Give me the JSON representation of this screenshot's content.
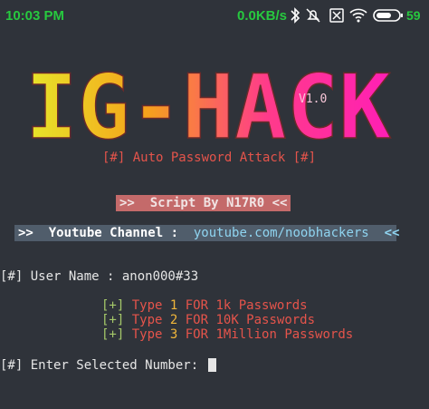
{
  "status_bar": {
    "time": "10:03 PM",
    "net_speed": "0.0KB/s",
    "battery_pct": "59",
    "icons": [
      "bluetooth-icon",
      "mute-icon",
      "sim-off-icon",
      "wifi-icon",
      "battery-icon"
    ],
    "color": "#27c93f"
  },
  "banner": {
    "logo_text": "IG-HACK",
    "version": "V1.0"
  },
  "terminal": {
    "tagline": "[#] Auto Password Attack [#]",
    "author": ">>  Script By N17R0 <<",
    "channel": {
      "prefix": ">>  Youtube Channel :  ",
      "url": "youtube.com/noobhackers",
      "suffix": "  <<"
    },
    "username_line": "[#] User Name : anon000#33",
    "options": [
      {
        "bracket": "[+]",
        "type_label": " Type ",
        "number": "1",
        "rest": " FOR 1k Passwords"
      },
      {
        "bracket": "[+]",
        "type_label": " Type ",
        "number": "2",
        "rest": " FOR 10K Passwords"
      },
      {
        "bracket": "[+]",
        "type_label": " Type ",
        "number": "3",
        "rest": " FOR 1Million Passwords"
      }
    ],
    "prompt": "[#] Enter Selected Number: "
  },
  "colors": {
    "background": "#2f333a",
    "accent_red": "#e5544b",
    "accent_green": "#a6c96a",
    "accent_yellow": "#f0b63a",
    "logo_gradient": [
      "#e7e62a",
      "#f6a21b",
      "#ff3b8a",
      "#ff1fb5"
    ]
  }
}
